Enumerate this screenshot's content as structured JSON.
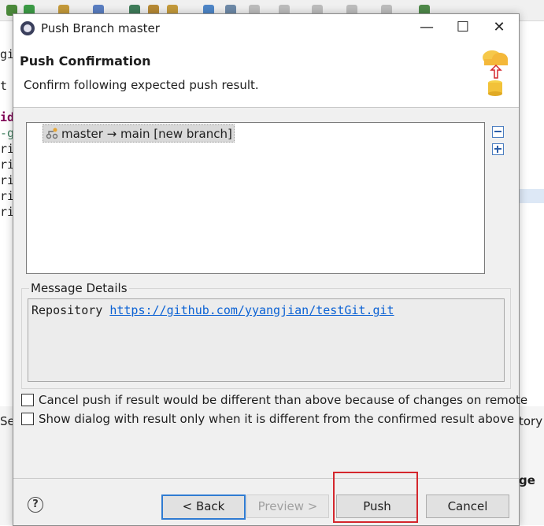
{
  "background": {
    "editor_lines": [
      "gi",
      "t",
      "id",
      "-g",
      "ri",
      "ri",
      "ri",
      "ri",
      "ri"
    ],
    "right_side": {
      "top_text": "tory",
      "bottom_text": "ge"
    },
    "left_side": {
      "bottom_text": "Ser"
    }
  },
  "dialog": {
    "title": "Push Branch master",
    "minimize_glyph": "—",
    "maximize_glyph": "☐",
    "close_glyph": "✕",
    "header": {
      "title": "Push Confirmation",
      "message": "Confirm following expected push result."
    },
    "tree": {
      "item": "master → main [new branch]"
    },
    "message_details": {
      "label": "Message Details",
      "repo_label": "Repository",
      "repo_url": "https://github.com/yyangjian/testGit.git"
    },
    "options": {
      "cancel_push": "Cancel push if result would be different than above because of changes on remote",
      "show_dialog": "Show dialog with result only when it is different from the confirmed result above"
    },
    "footer": {
      "help_glyph": "?",
      "back": "< Back",
      "preview": "Preview >",
      "push": "Push",
      "cancel": "Cancel"
    },
    "colors": {
      "highlight": "#d4272d",
      "link": "#0b62d4",
      "default_button_border": "#2f7bd2"
    }
  }
}
